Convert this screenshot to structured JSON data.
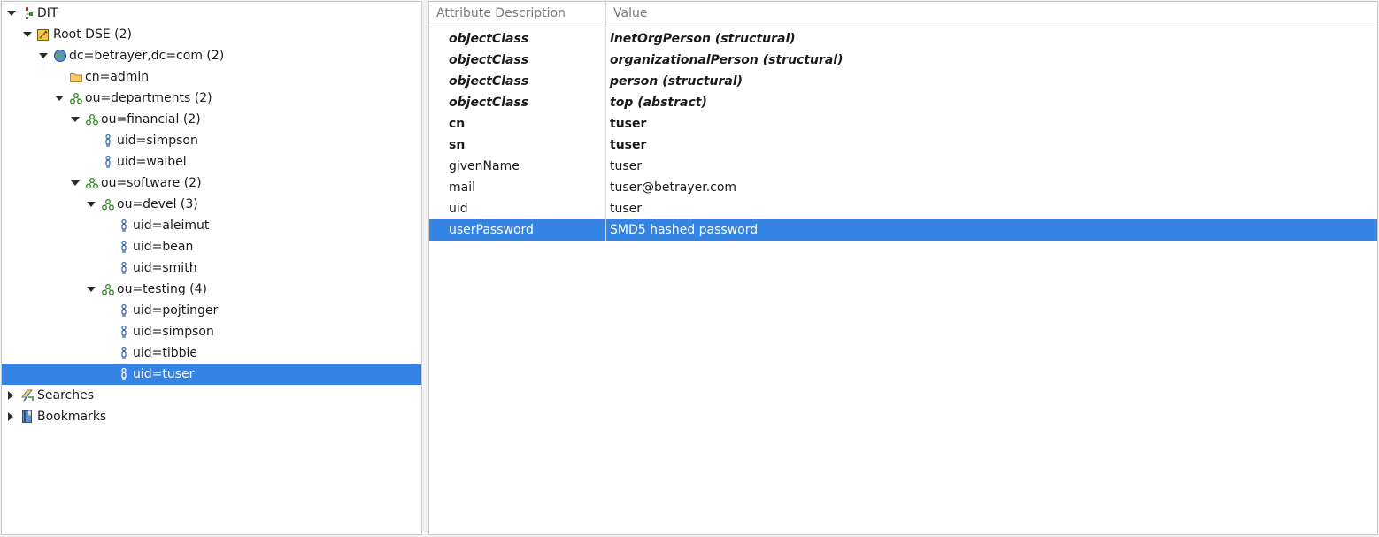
{
  "tree": {
    "items": [
      {
        "label": "DIT",
        "icon": "dit-icon",
        "state": "expanded"
      },
      {
        "label": "Root DSE (2)",
        "icon": "root-dse-icon",
        "state": "expanded"
      },
      {
        "label": "dc=betrayer,dc=com (2)",
        "icon": "globe-icon",
        "state": "expanded"
      },
      {
        "label": "cn=admin",
        "icon": "folder-icon",
        "state": "leaf"
      },
      {
        "label": "ou=departments (2)",
        "icon": "org-unit-icon",
        "state": "expanded"
      },
      {
        "label": "ou=financial (2)",
        "icon": "org-unit-icon",
        "state": "expanded"
      },
      {
        "label": "uid=simpson",
        "icon": "person-icon",
        "state": "leaf"
      },
      {
        "label": "uid=waibel",
        "icon": "person-icon",
        "state": "leaf"
      },
      {
        "label": "ou=software (2)",
        "icon": "org-unit-icon",
        "state": "expanded"
      },
      {
        "label": "ou=devel (3)",
        "icon": "org-unit-icon",
        "state": "expanded"
      },
      {
        "label": "uid=aleimut",
        "icon": "person-icon",
        "state": "leaf"
      },
      {
        "label": "uid=bean",
        "icon": "person-icon",
        "state": "leaf"
      },
      {
        "label": "uid=smith",
        "icon": "person-icon",
        "state": "leaf"
      },
      {
        "label": "ou=testing (4)",
        "icon": "org-unit-icon",
        "state": "expanded"
      },
      {
        "label": "uid=pojtinger",
        "icon": "person-icon",
        "state": "leaf"
      },
      {
        "label": "uid=simpson",
        "icon": "person-icon",
        "state": "leaf"
      },
      {
        "label": "uid=tibbie",
        "icon": "person-icon",
        "state": "leaf"
      },
      {
        "label": "uid=tuser",
        "icon": "person-icon",
        "state": "leaf",
        "selected": true
      },
      {
        "label": "Searches",
        "icon": "searches-icon",
        "state": "collapsed"
      },
      {
        "label": "Bookmarks",
        "icon": "bookmarks-icon",
        "state": "collapsed"
      }
    ]
  },
  "attributes": {
    "columns": {
      "description": "Attribute Description",
      "value": "Value"
    },
    "rows": [
      {
        "description": "objectClass",
        "value": "inetOrgPerson (structural)",
        "kind": "objectclass"
      },
      {
        "description": "objectClass",
        "value": "organizationalPerson (structural)",
        "kind": "objectclass"
      },
      {
        "description": "objectClass",
        "value": "person (structural)",
        "kind": "objectclass"
      },
      {
        "description": "objectClass",
        "value": "top (abstract)",
        "kind": "objectclass"
      },
      {
        "description": "cn",
        "value": "tuser",
        "kind": "must"
      },
      {
        "description": "sn",
        "value": "tuser",
        "kind": "must"
      },
      {
        "description": "givenName",
        "value": "tuser",
        "kind": "may"
      },
      {
        "description": "mail",
        "value": "tuser@betrayer.com",
        "kind": "may"
      },
      {
        "description": "uid",
        "value": "tuser",
        "kind": "may"
      },
      {
        "description": "userPassword",
        "value": "SMD5 hashed password",
        "kind": "may",
        "selected": true
      }
    ]
  },
  "colors": {
    "selection": "#3584e4",
    "org_unit_icon": "#3a8a2e",
    "person_icon": "#3a6db5",
    "folder_icon": "#e9b44c"
  }
}
